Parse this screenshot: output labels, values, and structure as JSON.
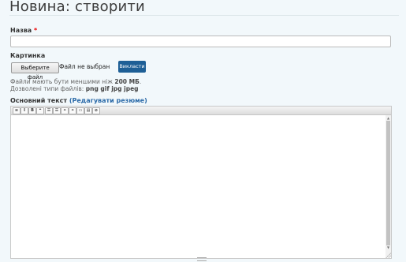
{
  "page": {
    "title": "Новина: створити"
  },
  "form": {
    "name_label": "Назва",
    "required_mark": "*",
    "image_label": "Картинка",
    "choose_file_label": "Выберите файл",
    "no_file_label": "Файл не выбран",
    "upload_label": "Викласти",
    "help_size_prefix": "Файли мають бути меншими ніж ",
    "help_size_value": "200 МБ",
    "help_size_suffix": ".",
    "help_types_prefix": "Дозволені типи файлів: ",
    "help_types_value": "png gif jpg jpeg",
    "body_label": "Основний текст",
    "body_edit_open": " (",
    "body_edit_link": "Редагувати резюме",
    "body_edit_close": ")"
  },
  "toolbar": {
    "buttons": [
      {
        "name": "source-icon",
        "glyph": "≡"
      },
      {
        "name": "italic-icon",
        "glyph": "I"
      },
      {
        "name": "bold-icon",
        "glyph": "B"
      },
      {
        "name": "blockquote-icon",
        "glyph": "❝"
      },
      {
        "name": "bulleted-list-icon",
        "glyph": "☰"
      },
      {
        "name": "numbered-list-icon",
        "glyph": "☰"
      },
      {
        "name": "link-icon",
        "glyph": "⚭"
      },
      {
        "name": "unlink-icon",
        "glyph": "⚭"
      },
      {
        "name": "image-icon",
        "glyph": "▭"
      },
      {
        "name": "paste-text-icon",
        "glyph": "▤"
      },
      {
        "name": "remove-format-icon",
        "glyph": "⊘"
      }
    ]
  }
}
